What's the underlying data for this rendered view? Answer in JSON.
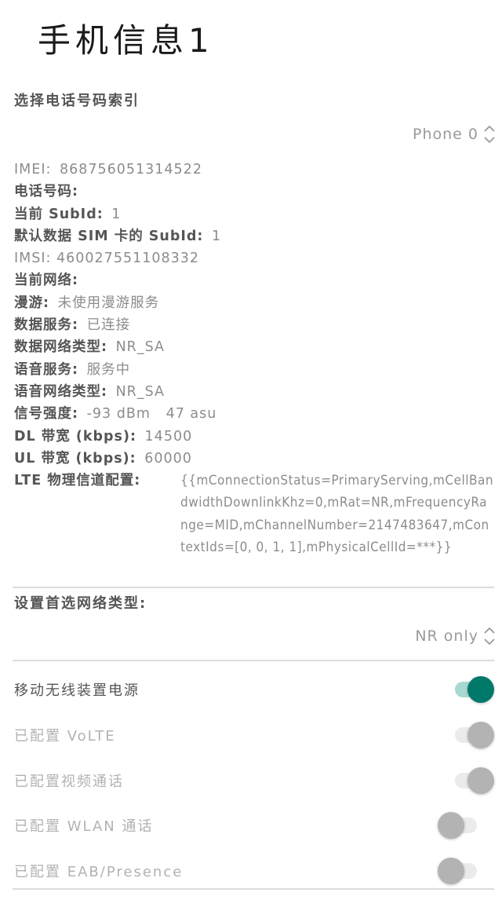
{
  "header": {
    "title": "手机信息1"
  },
  "phone_index": {
    "label": "选择电话号码索引",
    "selected": "Phone 0",
    "icon": "spinner-updown-icon"
  },
  "info": {
    "imei": {
      "label": "IMEI:",
      "value": "868756051314522"
    },
    "phone_number": {
      "label": "电话号码:",
      "value": ""
    },
    "current_subid": {
      "label": "当前 SubId:",
      "value": "1"
    },
    "default_data_subid": {
      "label": "默认数据 SIM 卡的 SubId:",
      "value": "1"
    },
    "imsi": {
      "label": "IMSI:",
      "value": "460027551108332"
    },
    "current_network": {
      "label": "当前网络:",
      "value": ""
    },
    "roaming": {
      "label": "漫游:",
      "value": "未使用漫游服务"
    },
    "data_service": {
      "label": "数据服务:",
      "value": "已连接"
    },
    "data_network_type": {
      "label": "数据网络类型:",
      "value": "NR_SA"
    },
    "voice_service": {
      "label": "语音服务:",
      "value": "服务中"
    },
    "voice_network_type": {
      "label": "语音网络类型:",
      "value": "NR_SA"
    },
    "signal_strength": {
      "label": "信号强度:",
      "value": "-93 dBm   47 asu"
    },
    "dl_bandwidth": {
      "label": "DL 带宽 (kbps):",
      "value": "14500"
    },
    "ul_bandwidth": {
      "label": "UL 带宽 (kbps):",
      "value": "60000"
    },
    "lte_physical_channel": {
      "label": "LTE 物理信道配置:",
      "value": "{{mConnectionStatus=PrimaryServing,mCellBandwidthDownlinkKhz=0,mRat=NR,mFrequencyRange=MID,mChannelNumber=2147483647,mContextIds=[0, 0, 1, 1],mPhysicalCellId=***}}"
    }
  },
  "preferred_network": {
    "label": "设置首选网络类型:",
    "selected": "NR only",
    "icon": "spinner-updown-icon"
  },
  "toggles": [
    {
      "label": "移动无线装置电源",
      "state": "on",
      "enabled": true
    },
    {
      "label": "已配置 VoLTE",
      "state": "on",
      "enabled": false
    },
    {
      "label": "已配置视频通话",
      "state": "on",
      "enabled": false
    },
    {
      "label": "已配置 WLAN 通话",
      "state": "off",
      "enabled": false
    },
    {
      "label": "已配置 EAB/Presence",
      "state": "off",
      "enabled": false
    }
  ],
  "colors": {
    "accent": "#00796b",
    "accent_track": "#a8d8d2",
    "disabled_thumb": "#b3b3b3",
    "disabled_track": "#ebebeb",
    "label_text": "#555555",
    "value_text": "#8c8c8c"
  }
}
